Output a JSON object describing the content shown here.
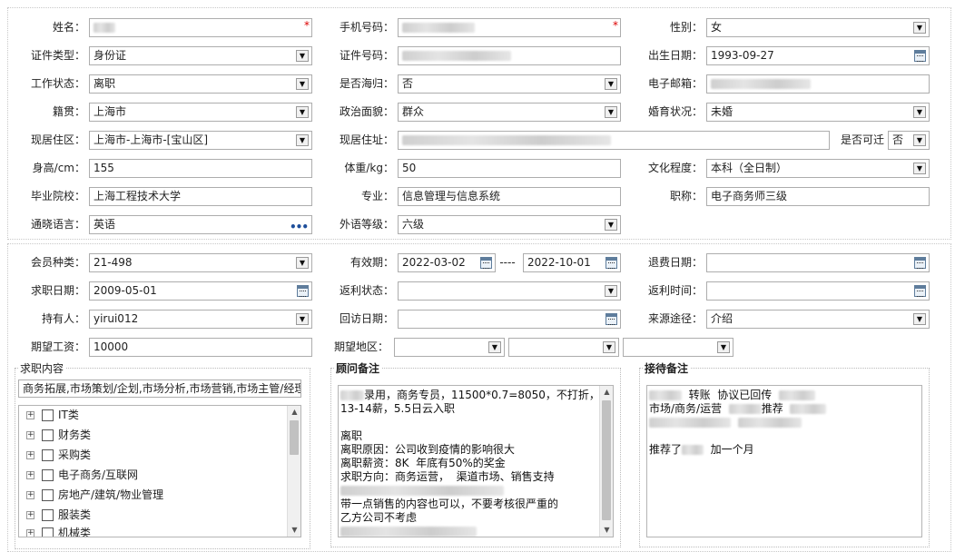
{
  "personal": {
    "name_label": "姓名：",
    "phone_label": "手机号码：",
    "gender_label": "性别：",
    "gender_value": "女",
    "id_type_label": "证件类型：",
    "id_type_value": "身份证",
    "id_no_label": "证件号码：",
    "birth_label": "出生日期：",
    "birth_value": "1993-09-27",
    "work_status_label": "工作状态：",
    "work_status_value": "离职",
    "overseas_label": "是否海归：",
    "overseas_value": "否",
    "email_label": "电子邮箱：",
    "native_label": "籍贯：",
    "native_value": "上海市",
    "political_label": "政治面貌：",
    "political_value": "群众",
    "marital_label": "婚育状况：",
    "marital_value": "未婚",
    "region_label": "现居住区：",
    "region_value": "上海市-上海市-[宝山区]",
    "address_label": "现居住址：",
    "relocate_label": "是否可迁",
    "relocate_value": "否",
    "height_label": "身高/cm：",
    "height_value": "155",
    "weight_label": "体重/kg：",
    "weight_value": "50",
    "education_label": "文化程度：",
    "education_value": "本科（全日制）",
    "school_label": "毕业院校：",
    "school_value": "上海工程技术大学",
    "major_label": "专业：",
    "major_value": "信息管理与信息系统",
    "title_label": "职称：",
    "title_value": "电子商务师三级",
    "language_label": "通晓语言：",
    "language_value": "英语",
    "lang_level_label": "外语等级：",
    "lang_level_value": "六级",
    "required_mark": "*",
    "more_glyph": "•••"
  },
  "member": {
    "type_label": "会员种类：",
    "type_value": "21-498",
    "valid_label": "有效期：",
    "valid_from": "2022-03-02",
    "valid_sep": "----",
    "valid_to": "2022-10-01",
    "refund_date_label": "退费日期：",
    "job_date_label": "求职日期：",
    "job_date_value": "2009-05-01",
    "rebate_status_label": "返利状态：",
    "rebate_time_label": "返利时间：",
    "holder_label": "持有人：",
    "holder_value": "yirui012",
    "visit_date_label": "回访日期：",
    "source_label": "来源途径：",
    "source_value": "介绍",
    "salary_label": "期望工资：",
    "salary_value": "10000",
    "area_label": "期望地区："
  },
  "job": {
    "title": "求职内容",
    "summary": "商务拓展,市场策划/企划,市场分析,市场营销,市场主管/经理",
    "categories": [
      "IT类",
      "财务类",
      "采购类",
      "电子商务/互联网",
      "房地产/建筑/物业管理",
      "服装类",
      "机械类"
    ]
  },
  "consultant": {
    "title": "顾问备注",
    "l1": "录用，商务专员，11500*0.7=8050，不打折，",
    "l2": "13-14薪，5.5日云入职",
    "l3": "离职",
    "l4": "离职原因：公司收到疫情的影响很大",
    "l5": "离职薪资：8K  年底有50%的奖金",
    "l6": "求职方向：商务运营，  渠道市场、销售支持",
    "l7": "带一点销售的内容也可以，不要考核很严重的",
    "l8": "乙方公司不考虑"
  },
  "reception": {
    "title": "接待备注",
    "l1": "转账  协议已回传",
    "l2": "市场/商务/运营",
    "l2b": "推荐",
    "l3": "推荐了",
    "l3b": "加一个月"
  }
}
